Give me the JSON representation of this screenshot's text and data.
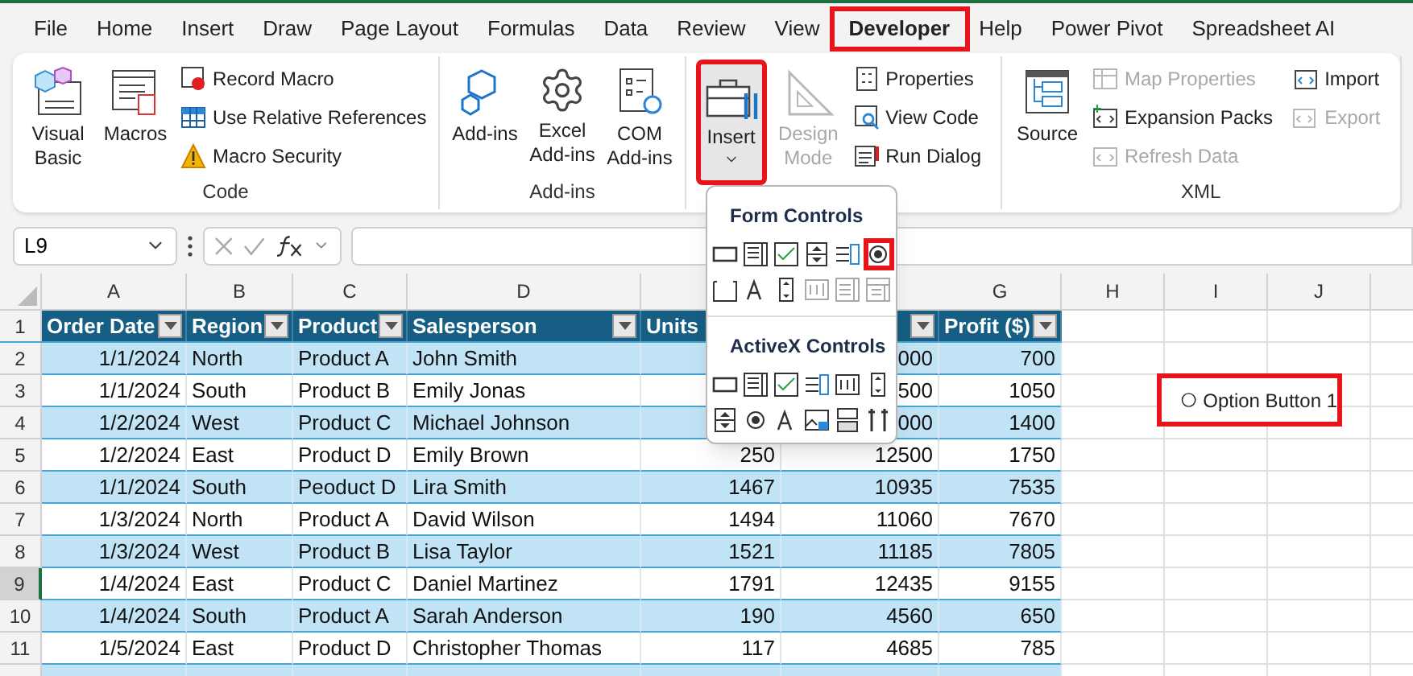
{
  "menu_tabs": [
    {
      "label": "File",
      "selected": false,
      "annotated": false
    },
    {
      "label": "Home",
      "selected": false,
      "annotated": false
    },
    {
      "label": "Insert",
      "selected": false,
      "annotated": false
    },
    {
      "label": "Draw",
      "selected": false,
      "annotated": false
    },
    {
      "label": "Page Layout",
      "selected": false,
      "annotated": false
    },
    {
      "label": "Formulas",
      "selected": false,
      "annotated": false
    },
    {
      "label": "Data",
      "selected": false,
      "annotated": false
    },
    {
      "label": "Review",
      "selected": false,
      "annotated": false
    },
    {
      "label": "View",
      "selected": false,
      "annotated": false
    },
    {
      "label": "Developer",
      "selected": true,
      "annotated": true
    },
    {
      "label": "Help",
      "selected": false,
      "annotated": false
    },
    {
      "label": "Power Pivot",
      "selected": false,
      "annotated": false
    },
    {
      "label": "Spreadsheet AI",
      "selected": false,
      "annotated": false
    }
  ],
  "ribbon": {
    "groups": [
      {
        "label": "Code",
        "items": [
          {
            "kind": "large",
            "label": "Visual Basic",
            "disabled": false
          },
          {
            "kind": "large",
            "label": "Macros",
            "disabled": false
          },
          {
            "kind": "small",
            "label": "Record Macro",
            "disabled": false
          },
          {
            "kind": "small",
            "label": "Use Relative References",
            "disabled": false
          },
          {
            "kind": "small",
            "label": "Macro Security",
            "disabled": false
          }
        ]
      },
      {
        "label": "Add-ins",
        "items": [
          {
            "kind": "large",
            "label": "Add-ins",
            "disabled": false
          },
          {
            "kind": "large",
            "label": "Excel Add-ins",
            "disabled": false
          },
          {
            "kind": "large",
            "label": "COM Add-ins",
            "disabled": false
          }
        ]
      },
      {
        "items": [
          {
            "kind": "dropdown",
            "label": "Insert",
            "disabled": false,
            "annotated": true
          },
          {
            "kind": "large",
            "label": "Design Mode",
            "disabled": true
          },
          {
            "kind": "small",
            "label": "Properties",
            "disabled": false
          },
          {
            "kind": "small",
            "label": "View Code",
            "disabled": false
          },
          {
            "kind": "small",
            "label": "Run Dialog",
            "disabled": false
          }
        ]
      },
      {
        "label": "XML",
        "items": [
          {
            "kind": "large",
            "label": "Source",
            "disabled": false
          },
          {
            "kind": "small",
            "label": "Map Properties",
            "disabled": true
          },
          {
            "kind": "small",
            "label": "Expansion Packs",
            "disabled": false
          },
          {
            "kind": "small",
            "label": "Refresh Data",
            "disabled": true
          },
          {
            "kind": "small",
            "label": "Import",
            "disabled": false
          },
          {
            "kind": "small",
            "label": "Export",
            "disabled": true
          }
        ]
      }
    ]
  },
  "insert_menu": {
    "sections": [
      {
        "title": "Form Controls",
        "items": [
          {
            "kind": "button",
            "disabled": false,
            "annotated": false
          },
          {
            "kind": "combo",
            "disabled": false,
            "annotated": false
          },
          {
            "kind": "checkbox",
            "disabled": false,
            "annotated": false
          },
          {
            "kind": "spin",
            "disabled": false,
            "annotated": false
          },
          {
            "kind": "list",
            "disabled": false,
            "annotated": false
          },
          {
            "kind": "option",
            "disabled": false,
            "annotated": true
          },
          {
            "kind": "group",
            "disabled": false,
            "annotated": false
          },
          {
            "kind": "label",
            "disabled": false,
            "annotated": false
          },
          {
            "kind": "scroll",
            "disabled": false,
            "annotated": false
          },
          {
            "kind": "textfield",
            "disabled": true,
            "annotated": false
          },
          {
            "kind": "combolist",
            "disabled": true,
            "annotated": false
          },
          {
            "kind": "combodrop",
            "disabled": true,
            "annotated": false
          }
        ]
      },
      {
        "title": "ActiveX Controls",
        "items": [
          {
            "kind": "button",
            "disabled": false,
            "annotated": false
          },
          {
            "kind": "combo",
            "disabled": false,
            "annotated": false
          },
          {
            "kind": "checkbox",
            "disabled": false,
            "annotated": false
          },
          {
            "kind": "list",
            "disabled": false,
            "annotated": false
          },
          {
            "kind": "textfield",
            "disabled": false,
            "annotated": false
          },
          {
            "kind": "scroll",
            "disabled": false,
            "annotated": false
          },
          {
            "kind": "spin",
            "disabled": false,
            "annotated": false
          },
          {
            "kind": "option",
            "disabled": false,
            "annotated": false
          },
          {
            "kind": "label",
            "disabled": false,
            "annotated": false
          },
          {
            "kind": "image",
            "disabled": false,
            "annotated": false
          },
          {
            "kind": "toggle",
            "disabled": false,
            "annotated": false
          },
          {
            "kind": "more",
            "disabled": false,
            "annotated": false
          }
        ]
      }
    ]
  },
  "formula_bar": {
    "name_box": "L9"
  },
  "sheet": {
    "columns": [
      "A",
      "B",
      "C",
      "D",
      null,
      null,
      "G",
      "H",
      "I",
      "J"
    ],
    "headers": [
      {
        "label": "Order Date",
        "filter": true
      },
      {
        "label": "Region",
        "filter": true
      },
      {
        "label": "Product",
        "filter": true
      },
      {
        "label": "Salesperson",
        "filter": true
      },
      {
        "label": "Units"
      },
      {
        "filter": true
      },
      {
        "label": "Profit ($)",
        "filter": true
      }
    ],
    "header_row": "1",
    "rows": [
      {
        "num": "2",
        "selected": false,
        "cells": [
          "1/1/2024",
          "North",
          "Product A",
          "John Smith",
          null,
          "000",
          "700"
        ]
      },
      {
        "num": "3",
        "selected": false,
        "cells": [
          "1/1/2024",
          "South",
          "Product B",
          "Emily Jonas",
          null,
          "500",
          "1050"
        ]
      },
      {
        "num": "4",
        "selected": false,
        "cells": [
          "1/2/2024",
          "West",
          "Product C",
          "Michael Johnson",
          null,
          "000",
          "1400"
        ]
      },
      {
        "num": "5",
        "selected": false,
        "cells": [
          "1/2/2024",
          "East",
          "Product D",
          "Emily Brown",
          "250",
          "12500",
          "1750"
        ]
      },
      {
        "num": "6",
        "selected": false,
        "cells": [
          "1/1/2024",
          "South",
          "Peoduct D",
          "Lira Smith",
          "1467",
          "10935",
          "7535"
        ]
      },
      {
        "num": "7",
        "selected": false,
        "cells": [
          "1/3/2024",
          "North",
          "Product A",
          "David Wilson",
          "1494",
          "11060",
          "7670"
        ]
      },
      {
        "num": "8",
        "selected": false,
        "cells": [
          "1/3/2024",
          "West",
          "Product B",
          "Lisa Taylor",
          "1521",
          "11185",
          "7805"
        ]
      },
      {
        "num": "9",
        "selected": true,
        "cells": [
          "1/4/2024",
          "East",
          "Product C",
          "Daniel Martinez",
          "1791",
          "12435",
          "9155"
        ]
      },
      {
        "num": "10",
        "selected": false,
        "cells": [
          "1/4/2024",
          "South",
          "Product A",
          "Sarah Anderson",
          "190",
          "4560",
          "650"
        ]
      },
      {
        "num": "11",
        "selected": false,
        "cells": [
          "1/5/2024",
          "East",
          "Product D",
          "Christopher Thomas",
          "117",
          "4685",
          "785"
        ]
      }
    ],
    "option_button": {
      "label": "Option Button 1",
      "selected": false,
      "annotated": true
    }
  }
}
